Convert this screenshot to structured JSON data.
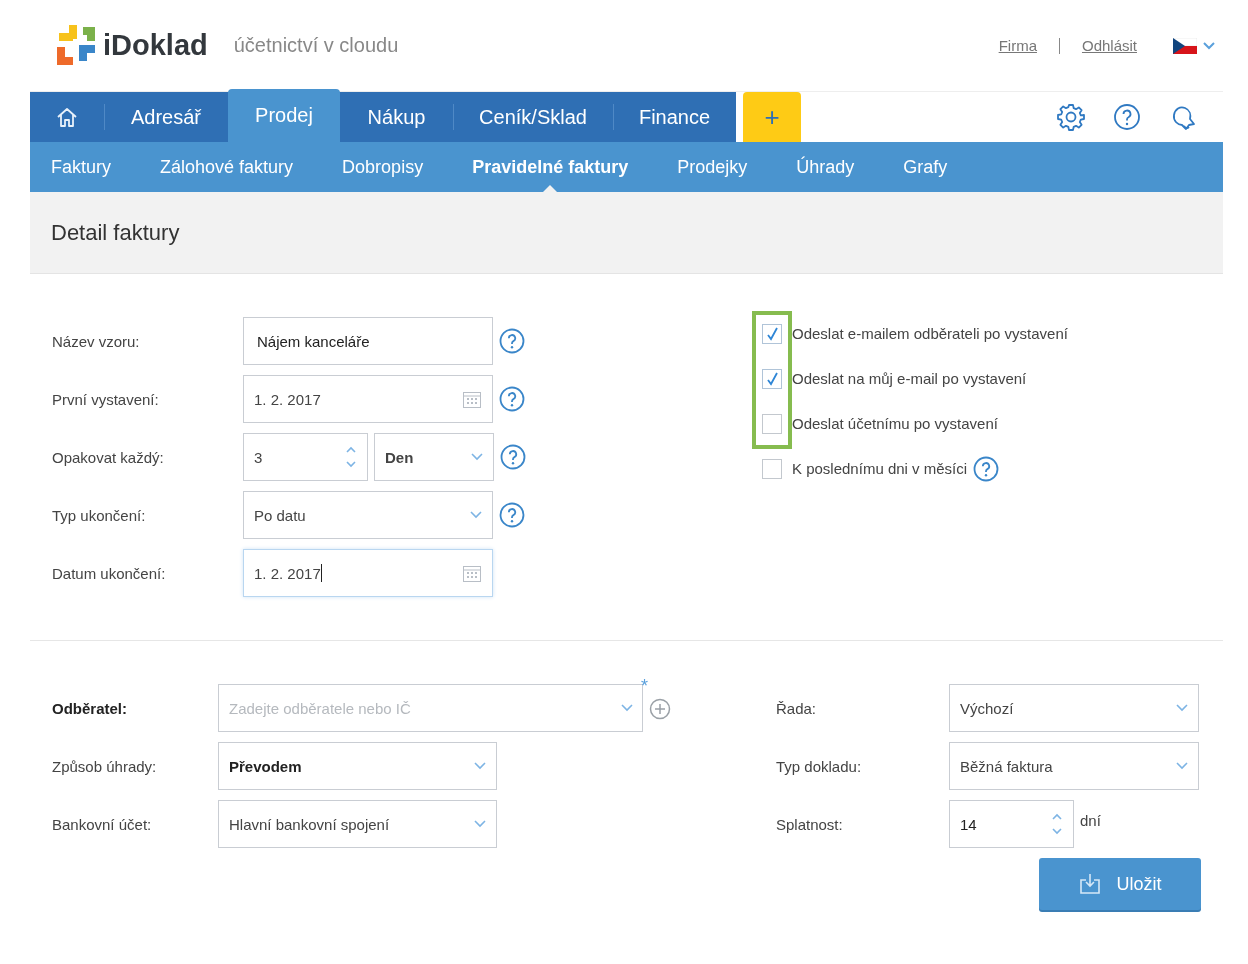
{
  "header": {
    "logo_text": "iDoklad",
    "tagline": "účetnictví v cloudu",
    "links": [
      "Firma",
      "Odhlásit"
    ]
  },
  "main_nav": {
    "items": [
      {
        "kind": "home",
        "selected": false
      },
      {
        "kind": "text",
        "label": "Adresář",
        "selected": false
      },
      {
        "kind": "text",
        "label": "Prodej",
        "selected": true
      },
      {
        "kind": "text",
        "label": "Nákup",
        "selected": false
      },
      {
        "kind": "text",
        "label": "Ceník/Sklad",
        "selected": false
      },
      {
        "kind": "text",
        "label": "Finance",
        "selected": false
      }
    ],
    "add_label": "+"
  },
  "sub_nav": [
    {
      "label": "Faktury",
      "selected": false
    },
    {
      "label": "Zálohové faktury",
      "selected": false
    },
    {
      "label": "Dobropisy",
      "selected": false
    },
    {
      "label": "Pravidelné faktury",
      "selected": true
    },
    {
      "label": "Prodejky",
      "selected": false
    },
    {
      "label": "Úhrady",
      "selected": false
    },
    {
      "label": "Grafy",
      "selected": false
    }
  ],
  "page_title": "Detail faktury",
  "template_form": [
    {
      "kind": "text",
      "label": "Název vzoru:",
      "value": "Nájem kanceláře",
      "help": true,
      "focused": false
    },
    {
      "kind": "date",
      "label": "První vystavení:",
      "value": "1. 2. 2017",
      "help": true,
      "focused": false
    },
    {
      "kind": "number_select",
      "label": "Opakovat každý:",
      "value": "3",
      "unit": "Den",
      "help": true,
      "focused": false
    },
    {
      "kind": "select",
      "label": "Typ ukončení:",
      "value": "Po datu",
      "help": true,
      "focused": false
    },
    {
      "kind": "date",
      "label": "Datum ukončení:",
      "value": "1. 2. 2017",
      "help": false,
      "focused": true
    }
  ],
  "checkbox_groups": [
    {
      "highlighted": true,
      "items": [
        {
          "label": "Odeslat e-mailem odběrateli po vystavení",
          "checked": true,
          "help": false
        },
        {
          "label": "Odeslat na můj e-mail po vystavení",
          "checked": true,
          "help": false
        },
        {
          "label": "Odeslat účetnímu po vystavení",
          "checked": false,
          "help": false
        }
      ]
    },
    {
      "highlighted": false,
      "items": [
        {
          "label": "K poslednímu dni v měsíci",
          "checked": false,
          "help": true
        }
      ]
    }
  ],
  "invoice_left": [
    {
      "kind": "combobox",
      "label": "Odběratel:",
      "placeholder": "Zadejte odběratele nebo IČ",
      "required_mark": "*",
      "strong_label": true
    },
    {
      "kind": "select",
      "label": "Způsob úhrady:",
      "value": "Převodem",
      "strong_label": false,
      "strong_value": true
    },
    {
      "kind": "select",
      "label": "Bankovní účet:",
      "value": "Hlavní bankovní spojení",
      "strong_label": false,
      "strong_value": false
    }
  ],
  "invoice_right": [
    {
      "kind": "select",
      "label": "Řada:",
      "value": "Výchozí"
    },
    {
      "kind": "select",
      "label": "Typ dokladu:",
      "value": "Běžná faktura"
    },
    {
      "kind": "number",
      "label": "Splatnost:",
      "value": "14",
      "suffix": "dní"
    }
  ],
  "save_button": "Uložit"
}
